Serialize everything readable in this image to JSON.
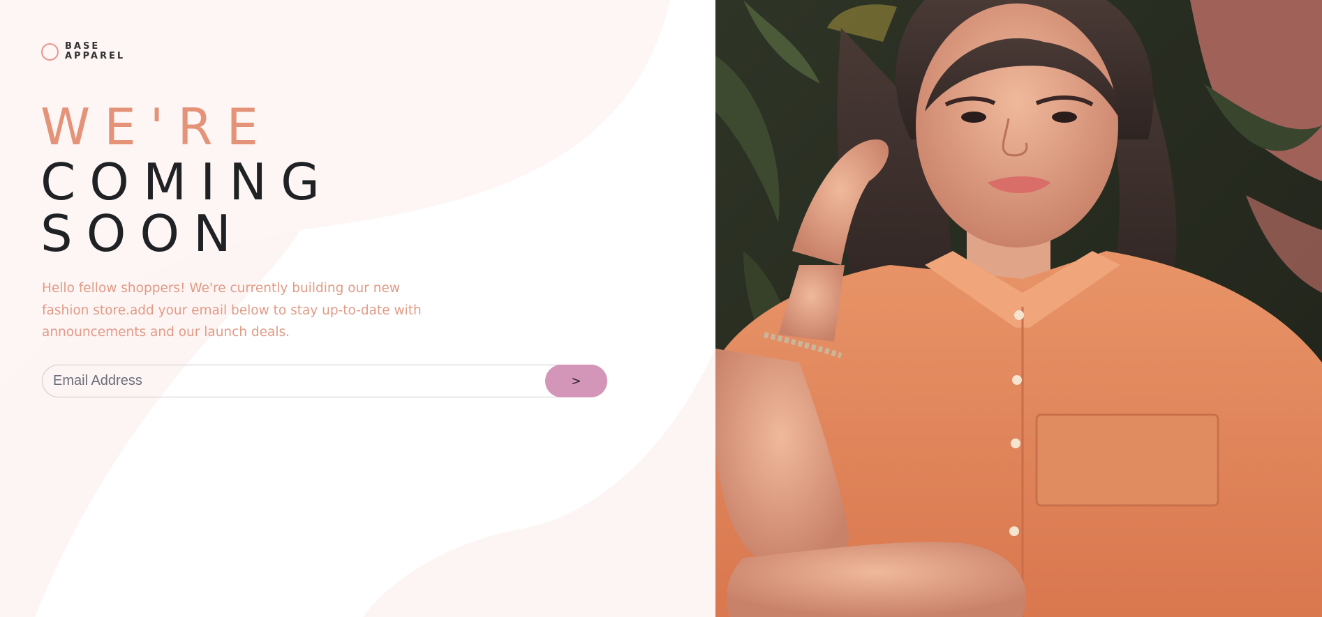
{
  "brand": {
    "line1": "BASE",
    "line2": "APPAREL"
  },
  "hero": {
    "line1": "WE'RE",
    "line2": "COMING",
    "line3": "SOON"
  },
  "description": "Hello fellow shoppers! We're currently building our new fashion store.add your email below to stay up-to-date with announcements and our launch deals.",
  "form": {
    "email_placeholder": "Email Address",
    "submit_label": ">"
  },
  "colors": {
    "accent_heading": "#e49379",
    "text_dark": "#1f2124",
    "description": "#e29a86",
    "button": "#d496b8",
    "logo_ring": "#e8968e"
  },
  "icons": {
    "logo": "circle-logo-icon"
  }
}
